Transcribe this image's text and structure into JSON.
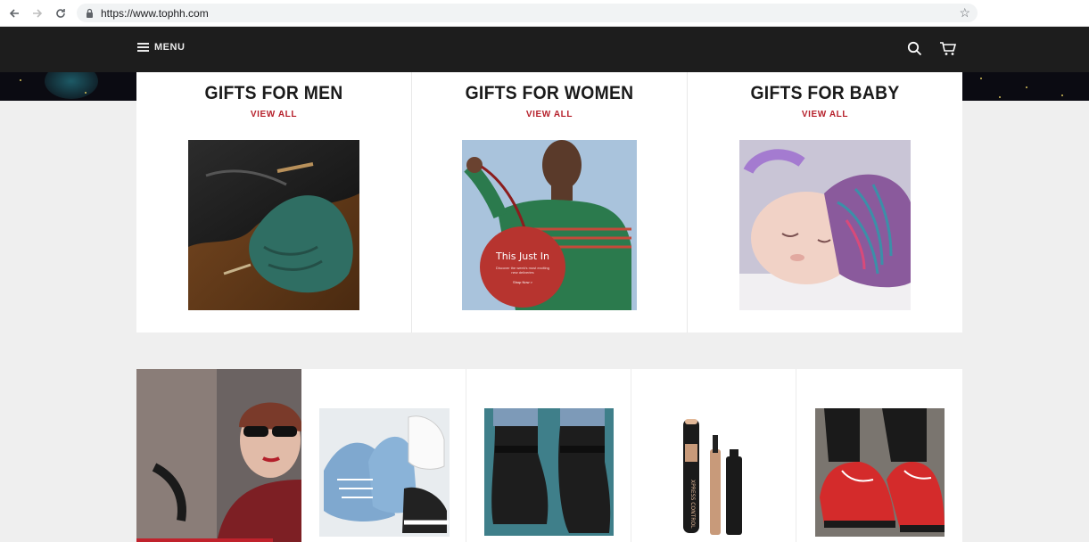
{
  "browser": {
    "url": "https://www.tophh.com",
    "back_icon": "arrow-left-icon",
    "forward_icon": "arrow-right-icon",
    "reload_icon": "reload-icon",
    "lock_icon": "lock-icon",
    "bookmark_icon": "star-icon"
  },
  "header": {
    "menu_label": "MENU",
    "menu_icon": "hamburger-icon",
    "search_icon": "search-icon",
    "cart_icon": "cart-icon",
    "background": "#1d1d1d"
  },
  "gifts": [
    {
      "title": "GIFTS FOR MEN",
      "link": "VIEW ALL",
      "image": "leather-shoes-and-tie-photo"
    },
    {
      "title": "GIFTS FOR WOMEN",
      "link": "VIEW ALL",
      "image": "woman-with-red-bag-photo",
      "image_text": "This Just In",
      "image_subtext": "Discover the week's most exciting new deliveries",
      "image_button": "Shop Now >"
    },
    {
      "title": "GIFTS FOR BABY",
      "link": "VIEW ALL",
      "image": "sleeping-baby-photo"
    }
  ],
  "products": [
    {
      "image": "woman-sunglasses-photo"
    },
    {
      "image": "blue-sneakers-photo"
    },
    {
      "image": "black-ankle-boots-photo"
    },
    {
      "image": "mascara-photo",
      "image_text": "XPRESS CONTROL"
    },
    {
      "image": "red-loafers-photo"
    }
  ],
  "colors": {
    "accent": "#b6212c",
    "page_bg": "#efefef"
  }
}
